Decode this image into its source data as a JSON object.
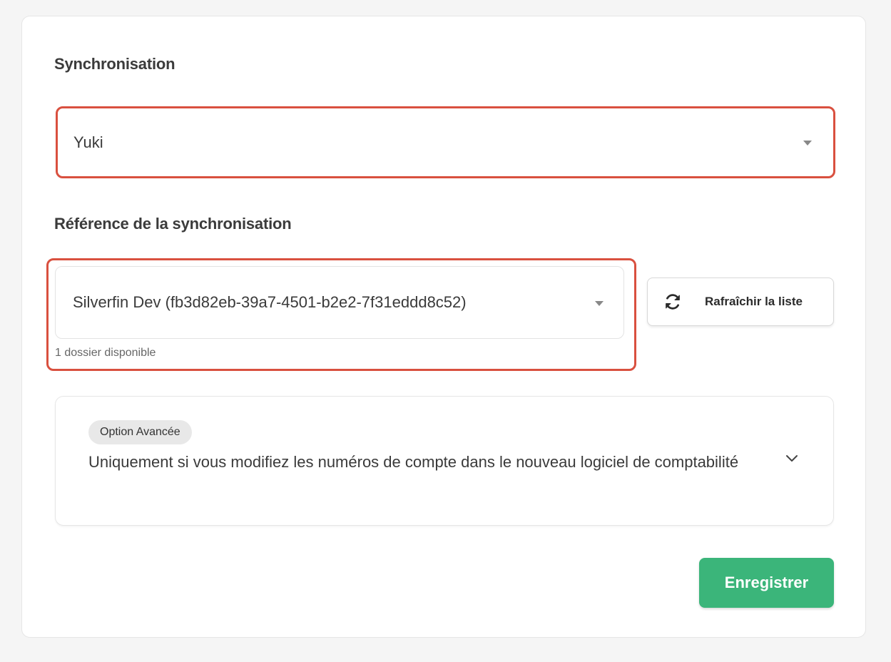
{
  "sync": {
    "label": "Synchronisation",
    "selected": "Yuki"
  },
  "reference": {
    "label": "Référence de la synchronisation",
    "selected": "Silverfin Dev (fb3d82eb-39a7-4501-b2e2-7f31eddd8c52)",
    "hint": "1 dossier disponible",
    "refresh_label": "Rafraîchir la liste"
  },
  "advanced": {
    "badge": "Option Avancée",
    "description": "Uniquement si vous modifiez les numéros de compte dans le nouveau logiciel de comptabilité"
  },
  "actions": {
    "save_label": "Enregistrer"
  },
  "icons": {
    "refresh": "refresh-icon",
    "caret": "caret-down-icon",
    "chevron": "chevron-down-icon"
  },
  "colors": {
    "highlight": "#d9503f",
    "primary": "#3bb57a",
    "badge_bg": "#e8e8e8"
  }
}
